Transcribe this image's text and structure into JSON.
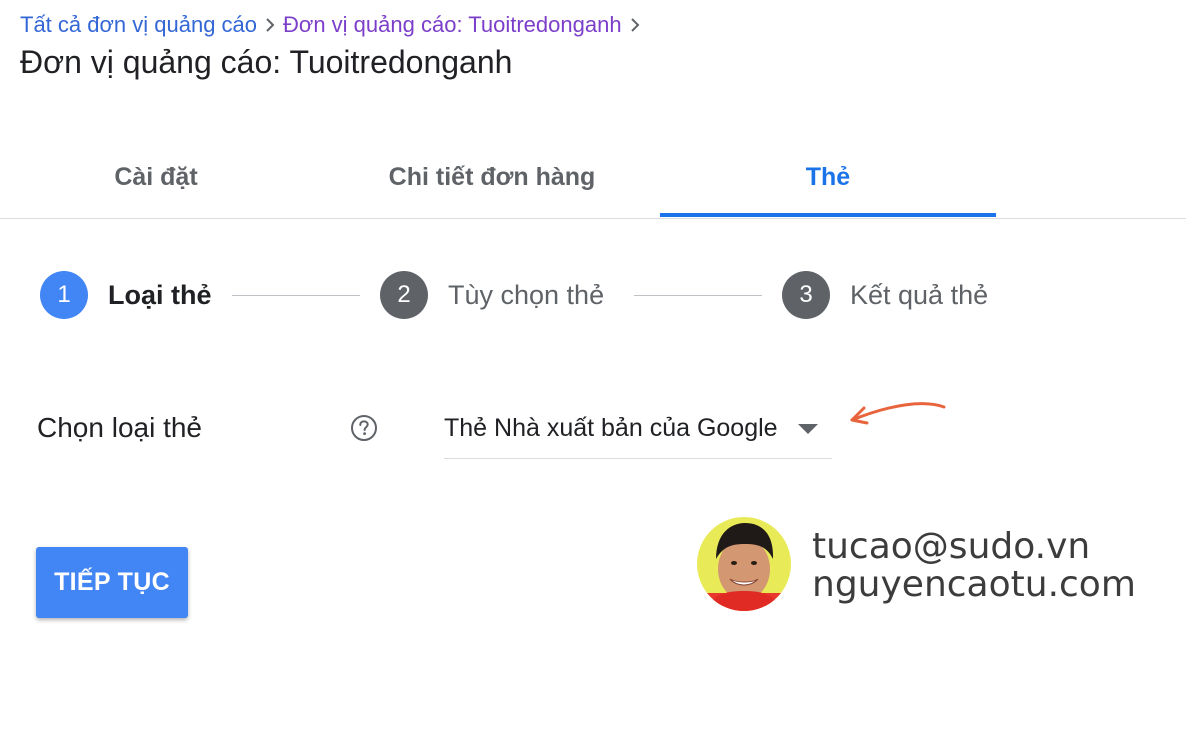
{
  "breadcrumb": {
    "items": [
      "Tất cả đơn vị quảng cáo",
      "Đơn vị quảng cáo: Tuoitredonganh"
    ]
  },
  "page_title": "Đơn vị quảng cáo: Tuoitredonganh",
  "tabs": [
    {
      "label": "Cài đặt",
      "active": false
    },
    {
      "label": "Chi tiết đơn hàng",
      "active": false
    },
    {
      "label": "Thẻ",
      "active": true
    }
  ],
  "stepper": {
    "steps": [
      {
        "number": "1",
        "label": "Loại thẻ",
        "active": true
      },
      {
        "number": "2",
        "label": "Tùy chọn thẻ",
        "active": false
      },
      {
        "number": "3",
        "label": "Kết quả thẻ",
        "active": false
      }
    ]
  },
  "form": {
    "tag_type_label": "Chọn loại thẻ",
    "tag_type_value": "Thẻ Nhà xuất bản của Google"
  },
  "continue_label": "TIẾP TỤC",
  "watermark": {
    "line1": "tucao@sudo.vn",
    "line2": "nguyencaotu.com"
  },
  "colors": {
    "accent": "#1a73e8",
    "link": "#3367d6",
    "visited_link": "#7b3fc9",
    "step_active": "#4285f4",
    "step_inactive": "#5f6368",
    "annotation_arrow": "#e8643c"
  },
  "icons": {
    "breadcrumb_separator": "chevron-right-icon",
    "help": "help-circle-icon",
    "dropdown": "caret-down-icon"
  }
}
